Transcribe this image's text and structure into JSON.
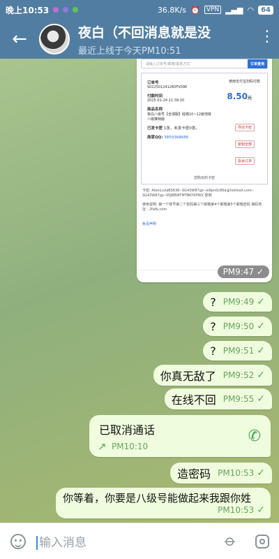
{
  "status_bar": {
    "time": "晚上10:53",
    "network_speed": "36.8K/s",
    "vpn": "VPN",
    "battery": "64"
  },
  "header": {
    "name": "夜白（不回消息就是没",
    "last_seen": "最近上线于今天PM10:51"
  },
  "screenshot_preview": {
    "search_placeholder": "请输入订单号/邮箱/联系方式",
    "search_button": "订单查询",
    "order_label": "订单号",
    "order_no": "S022501241260FV096",
    "pay_label": "使用支付宝扫码付款",
    "amount": "8.50",
    "amount_unit": "元",
    "time_label": "付款时间",
    "time_value": "2025-01-24 21:39:20",
    "goods_label": "商品名称",
    "goods_value": "夜白八级号【全球服】经典10~12级地铁八级推特版",
    "card_label": "已发卡密",
    "card_value": "1张，未发卡密0张。",
    "qq_label": "商家QQ:",
    "qq_value": "3859368686",
    "btn_export": "导出卡密",
    "btn_copy": "复制全部",
    "btn_complaint": "投诉订单",
    "card_title": "您购买的卡密",
    "card_detail": "卡密: AllenLiviaBS638--SG43W87gz--le9pn0c86a@hotmail.com--SG43W87gz--V0J8BWTMTBKYKPWX 复制",
    "usage": "使用说明: 第一个账号第二个密码第三个邮箱第4个邮箱第5个邮箱密码 接码地址：2fafb.com",
    "disclaimer": "免责声明",
    "time": "PM9:47"
  },
  "messages": [
    {
      "text": "?",
      "time": "PM9:49"
    },
    {
      "text": "?",
      "time": "PM9:50"
    },
    {
      "text": "?",
      "time": "PM9:51"
    },
    {
      "text": "你真无敌了",
      "time": "PM9:52"
    },
    {
      "text": "在线不回",
      "time": "PM9:55"
    },
    {
      "text": "造密码",
      "time": "PM10:53"
    }
  ],
  "call": {
    "title": "已取消通话",
    "time": "PM10:10"
  },
  "long_message": {
    "text": "你等着，你要是八级号能做起来我跟你姓",
    "time": "PM10:53"
  },
  "input": {
    "placeholder": "输入消息"
  },
  "colors": {
    "header": "#517da2",
    "bubble": "#effdde",
    "check": "#4fae4e"
  }
}
